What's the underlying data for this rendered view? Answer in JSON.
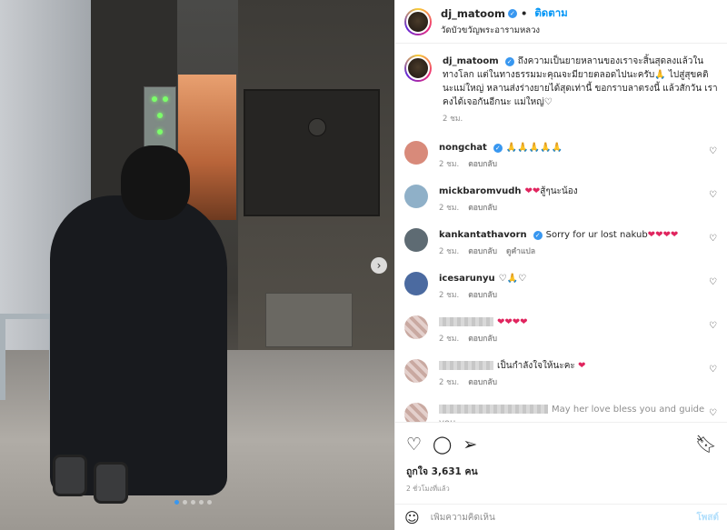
{
  "post": {
    "username": "dj_matoom",
    "follow_label": "ติดตาม",
    "location": "วัดบัวขวัญพระอารามหลวง",
    "caption": "ถึงความเป็นยายหลานของเราจะสิ้นสุดลงแล้วในทางโลก แต่ในทางธรรมมะคุณจะมียายตลอดไปนะครับ🙏 ไปสู่สุขคตินะแม่ใหญ่ หลานส่งร่างยายได้สุดเท่านี้ ขอกราบลาตรงนี้ แล้วสักวัน เราคงได้เจอกันอีกนะ แม่ใหญ่♡",
    "caption_time": "2 ชม."
  },
  "comments": [
    {
      "username": "nongchat",
      "verified": true,
      "text": "🙏🙏🙏🙏🙏",
      "time": "2 ชม.",
      "reply": "ตอบกลับ",
      "translate": ""
    },
    {
      "username": "mickbaromvudh",
      "verified": false,
      "text": "❤❤สู้ๆนะน้อง",
      "time": "2 ชม.",
      "reply": "ตอบกลับ",
      "translate": ""
    },
    {
      "username": "kankantathavorn",
      "verified": true,
      "text": "Sorry for ur lost nakub❤❤❤❤",
      "time": "2 ชม.",
      "reply": "ตอบกลับ",
      "translate": "ดูคำแปล"
    },
    {
      "username": "icesarunyu",
      "verified": false,
      "text": "♡🙏♡",
      "time": "2 ชม.",
      "reply": "ตอบกลับ",
      "translate": ""
    },
    {
      "username": "",
      "verified": false,
      "text": "❤❤❤❤",
      "time": "2 ชม.",
      "reply": "ตอบกลับ",
      "translate": ""
    },
    {
      "username": "",
      "verified": false,
      "text": "เป็นกำลังใจให้นะคะ ❤",
      "time": "2 ชม.",
      "reply": "ตอบกลับ",
      "translate": ""
    },
    {
      "username": "",
      "verified": false,
      "text": "May her love bless you and guide you",
      "time": "",
      "reply": "",
      "translate": ""
    }
  ],
  "likes_text": "ถูกใจ 3,631 คน",
  "posted_ago": "2 ชั่วโมงที่แล้ว",
  "composer": {
    "placeholder": "เพิ่มความคิดเห็น",
    "post_label": "โพสต์"
  },
  "carousel": {
    "total": 5,
    "active": 1
  },
  "icons": {
    "like": "heart-outline-icon",
    "comment": "comment-bubble-icon",
    "share": "paper-plane-icon",
    "save": "bookmark-icon",
    "emoji": "smiley-icon",
    "next": "chevron-right-icon"
  },
  "colors": {
    "link": "#0095f6",
    "verified": "#3897f0",
    "heart": "#e0245e"
  }
}
